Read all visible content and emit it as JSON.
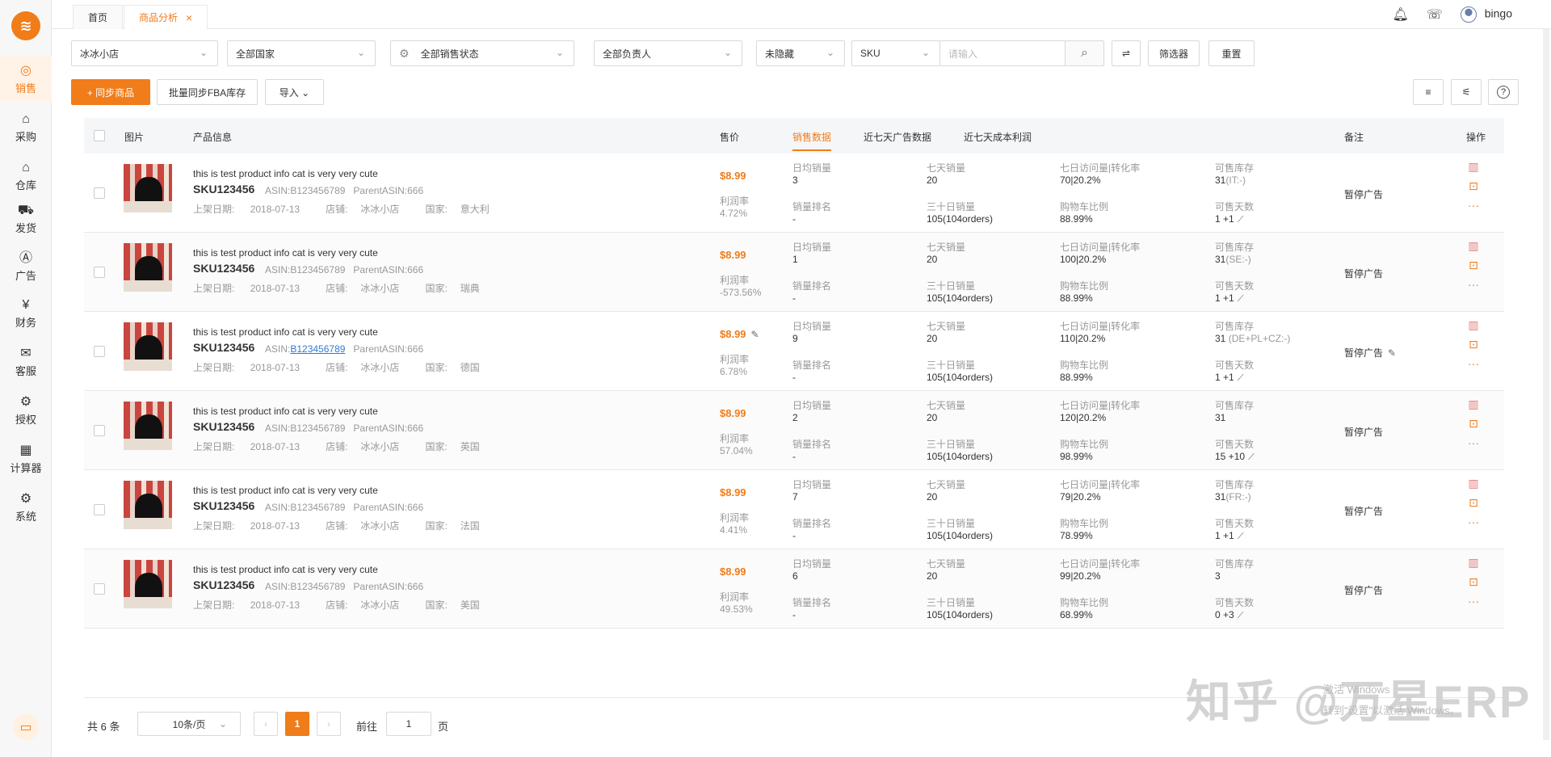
{
  "sidebar": {
    "logo": "≋",
    "items": [
      {
        "label": "销售",
        "icon": "◎"
      },
      {
        "label": "采购",
        "icon": "⌂"
      },
      {
        "label": "仓库",
        "icon": "⌂"
      },
      {
        "label": "发货",
        "icon": "⛟"
      },
      {
        "label": "广告",
        "icon": "Ⓐ"
      },
      {
        "label": "财务",
        "icon": "¥"
      },
      {
        "label": "客服",
        "icon": "✉"
      },
      {
        "label": "授权",
        "icon": "⚙"
      },
      {
        "label": "计算器",
        "icon": "▦"
      },
      {
        "label": "系统",
        "icon": "⚙"
      }
    ],
    "bottom_icon": "▭"
  },
  "tabs": [
    {
      "label": "首页"
    },
    {
      "label": "商品分析",
      "close": "×"
    }
  ],
  "topright": {
    "bell": "🔔",
    "headset": "🎧",
    "user": "bingo"
  },
  "filters": {
    "store": "冰冰小店",
    "country": "全部国家",
    "sale_status": "全部销售状态",
    "owner": "全部负责人",
    "hidden": "未隐藏",
    "search_type": "SKU",
    "search_placeholder": "请输入",
    "search_icon": "⌕",
    "sort_icon": "⇌",
    "filter_btn": "筛选器",
    "reset_btn": "重置"
  },
  "actions": {
    "sync": "+ 同步商品",
    "fba": "批量同步FBA库存",
    "import": "导入 ⌄",
    "icon1": "≡",
    "icon2": "⚟",
    "help": "?"
  },
  "table": {
    "headers": {
      "image": "图片",
      "info": "产品信息",
      "price": "售价",
      "sales": "销售数据",
      "ads": "近七天广告数据",
      "profit": "近七天成本利润",
      "note": "备注",
      "ops": "操作"
    },
    "labels": {
      "avg_sales": "日均销量",
      "rank": "销量排名",
      "seven_sales": "七天销量",
      "thirty_sales": "三十日销量",
      "visits": "七日访问量|转化率",
      "buybox": "购物车比例",
      "stock": "可售库存",
      "days": "可售天数",
      "margin": "利润率",
      "listed": "上架日期:",
      "shop": "店铺:",
      "country": "国家:"
    },
    "rows": [
      {
        "title": "this is test product info cat is very very cute",
        "sku": "SKU123456",
        "asin_prefix": "ASIN:",
        "asin": "B123456789",
        "parent": "ParentASIN:666",
        "date": "2018-07-13",
        "shop": "冰冰小店",
        "country": "意大利",
        "price": "$8.99",
        "margin": "4.72%",
        "avg": "3",
        "rank": "-",
        "seven": "20",
        "thirty": "105(104orders)",
        "visits": "70|20.2%",
        "buybox": "88.99%",
        "stock": "31",
        "stock_sub": "(IT:-)",
        "days": "1 +1",
        "note": "暂停广告"
      },
      {
        "title": "this is test product info cat is very very cute",
        "sku": "SKU123456",
        "asin_prefix": "ASIN:",
        "asin": "B123456789",
        "parent": "ParentASIN:666",
        "date": "2018-07-13",
        "shop": "冰冰小店",
        "country": "瑞典",
        "price": "$8.99",
        "margin": "-573.56%",
        "avg": "1",
        "rank": "-",
        "seven": "20",
        "thirty": "105(104orders)",
        "visits": "100|20.2%",
        "buybox": "88.99%",
        "stock": "31",
        "stock_sub": "(SE:-)",
        "days": "1 +1",
        "note": "暂停广告"
      },
      {
        "title": "this is test product info cat is very very cute",
        "sku": "SKU123456",
        "asin_prefix": "ASIN:",
        "asin": "B123456789",
        "parent": "ParentASIN:666",
        "date": "2018-07-13",
        "shop": "冰冰小店",
        "country": "德国",
        "price": "$8.99",
        "margin": "6.78%",
        "avg": "9",
        "rank": "-",
        "seven": "20",
        "thirty": "105(104orders)",
        "visits": "110|20.2%",
        "buybox": "88.99%",
        "stock": "31",
        "stock_sub": " (DE+PL+CZ:-)",
        "days": "1 +1",
        "note": "暂停广告"
      },
      {
        "title": "this is test product info cat is very very cute",
        "sku": "SKU123456",
        "asin_prefix": "ASIN:",
        "asin": "B123456789",
        "parent": "ParentASIN:666",
        "date": "2018-07-13",
        "shop": "冰冰小店",
        "country": "英国",
        "price": "$8.99",
        "margin": "57.04%",
        "avg": "2",
        "rank": "-",
        "seven": "20",
        "thirty": "105(104orders)",
        "visits": "120|20.2%",
        "buybox": "98.99%",
        "stock": "31",
        "stock_sub": "",
        "days": "15 +10",
        "note": "暂停广告"
      },
      {
        "title": "this is test product info cat is very very cute",
        "sku": "SKU123456",
        "asin_prefix": "ASIN:",
        "asin": "B123456789",
        "parent": "ParentASIN:666",
        "date": "2018-07-13",
        "shop": "冰冰小店",
        "country": "法国",
        "price": "$8.99",
        "margin": "4.41%",
        "avg": "7",
        "rank": "-",
        "seven": "20",
        "thirty": "105(104orders)",
        "visits": "79|20.2%",
        "buybox": "78.99%",
        "stock": "31",
        "stock_sub": "(FR:-)",
        "days": "1 +1",
        "note": "暂停广告"
      },
      {
        "title": "this is test product info cat is very very cute",
        "sku": "SKU123456",
        "asin_prefix": "ASIN:",
        "asin": "B123456789",
        "parent": "ParentASIN:666",
        "date": "2018-07-13",
        "shop": "冰冰小店",
        "country": "美国",
        "price": "$8.99",
        "margin": "49.53%",
        "avg": "6",
        "rank": "-",
        "seven": "20",
        "thirty": "105(104orders)",
        "visits": "99|20.2%",
        "buybox": "68.99%",
        "stock": "3",
        "stock_sub": "",
        "days": "0 +3",
        "note": "暂停广告"
      }
    ]
  },
  "pagination": {
    "total": "共 6 条",
    "per_page": "10条/页",
    "prev": "‹",
    "current": "1",
    "next": "›",
    "goto": "前往",
    "goto_value": "1",
    "page_suffix": "页"
  },
  "watermark": {
    "main": "知乎 @万星ERP",
    "line1": "激活 Windows",
    "line2": "转到\"设置\"以激活 Windows。"
  },
  "colors": {
    "accent": "#f07c1a",
    "link": "#2f7bd6"
  }
}
